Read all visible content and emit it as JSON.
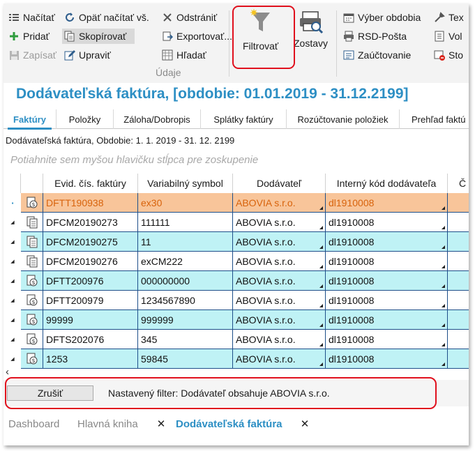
{
  "ribbon": {
    "group1": {
      "nacitat": "Načítať",
      "opat_nacitat": "Opäť načítať vš.",
      "odstranit": "Odstrániť",
      "pridat": "Pridať",
      "skopirovat": "Skopírovať",
      "exportovat": "Exportovať...",
      "zapisat": "Zapísať",
      "upravit": "Upraviť",
      "hladat": "Hľadať",
      "label": "Údaje"
    },
    "filtrovat": "Filtrovať",
    "zostavy": "Zostavy",
    "group3": {
      "vyber_obdobia": "Výber obdobia",
      "rsd_posta": "RSD-Pošta",
      "zauctovanie": "Zaúčtovanie",
      "tex": "Tex",
      "vol": "Vol",
      "sto": "Sto"
    }
  },
  "page_title": "Dodávateľská faktúra, [obdobie: 01.01.2019 - 31.12.2199]",
  "tabs": [
    "Faktúry",
    "Položky",
    "Záloha/Dobropis",
    "Splátky faktúry",
    "Rozúčtovanie položiek",
    "Prehľad faktú"
  ],
  "subtitle": "Dodávateľská faktúra, Obdobie: 1. 1. 2019 - 31. 12. 2199",
  "group_hint": "Potiahnite sem myšou hlavičku stĺpca pre zoskupenie",
  "columns": [
    "Evid. čís. faktúry",
    "Variabilný symbol",
    "Dodávateľ",
    "Interný kód dodávateľa",
    "Č"
  ],
  "rows": [
    {
      "evid": "DFTT190938",
      "vs": "ex30",
      "dod": "ABOVIA s.r.o.",
      "kod": "dl1910008",
      "icon": "dollar-doc-icon",
      "selected": true
    },
    {
      "evid": "DFCM20190273",
      "vs": "111111",
      "dod": "ABOVIA s.r.o.",
      "kod": "dl1910008",
      "icon": "doc-icon",
      "selected": false
    },
    {
      "evid": "DFCM20190275",
      "vs": "11",
      "dod": "ABOVIA s.r.o.",
      "kod": "dl1910008",
      "icon": "doc-icon",
      "selected": false
    },
    {
      "evid": "DFCM20190276",
      "vs": "exCM222",
      "dod": "ABOVIA s.r.o.",
      "kod": "dl1910008",
      "icon": "doc-icon",
      "selected": false
    },
    {
      "evid": "DFTT200976",
      "vs": "000000000",
      "dod": "ABOVIA s.r.o.",
      "kod": "dl1910008",
      "icon": "dollar-doc-icon",
      "selected": false
    },
    {
      "evid": "DFTT200979",
      "vs": "1234567890",
      "dod": "ABOVIA s.r.o.",
      "kod": "dl1910008",
      "icon": "dollar-doc-icon",
      "selected": false
    },
    {
      "evid": "99999",
      "vs": "999999",
      "dod": "ABOVIA s.r.o.",
      "kod": "dl1910008",
      "icon": "dollar-doc-icon",
      "selected": false
    },
    {
      "evid": "DFTS202076",
      "vs": "345",
      "dod": "ABOVIA s.r.o.",
      "kod": "dl1910008",
      "icon": "dollar-doc-icon",
      "selected": false
    },
    {
      "evid": "1253",
      "vs": "59845",
      "dod": "ABOVIA s.r.o.",
      "kod": "dl1910008",
      "icon": "dollar-doc-icon",
      "selected": false
    }
  ],
  "filter_bar": {
    "cancel": "Zrušiť",
    "text": "Nastavený filter: Dodávateľ obsahuje ABOVIA s.r.o."
  },
  "doc_tabs": [
    "Dashboard",
    "Hlavná kniha",
    "Dodávateľská faktúra"
  ],
  "colors": {
    "accent": "#2d8fc4",
    "row_selected": "#f8c59a",
    "row_even": "#ffffff",
    "row_odd": "#bff2f5",
    "selected_text": "#d8630c",
    "highlight_ring": "#e0101d"
  }
}
